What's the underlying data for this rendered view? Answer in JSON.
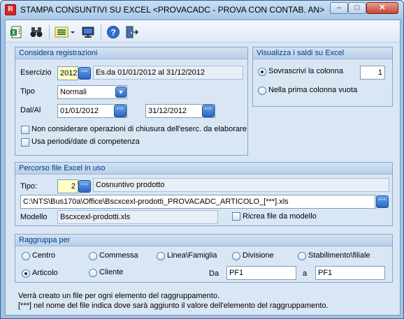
{
  "window": {
    "title": "STAMPA CONSUNTIVI SU EXCEL <PROVACADC - PROVA CON CONTAB. AN>",
    "app_icon": "R"
  },
  "toolbar": {
    "icons": [
      "export-excel-icon",
      "binoculars-icon",
      "list-menu-icon",
      "monitor-icon",
      "help-icon",
      "exit-icon"
    ]
  },
  "registrazioni": {
    "header": "Considera registrazioni",
    "esercizio_label": "Esercizio",
    "esercizio_value": "2012",
    "esercizio_desc": "Es.da 01/01/2012 al 31/12/2012",
    "tipo_label": "Tipo",
    "tipo_value": "Normali",
    "dalal_label": "Dal/Al",
    "dal_value": "01/01/2012",
    "al_value": "31/12/2012",
    "chk_chiusura_label": "Non considerare operazioni di chiusura dell'eserc. da elaborare",
    "chk_competenza_label": "Usa periodi/date di competenza"
  },
  "saldi": {
    "header": "Visualizza i saldi su Excel",
    "opt_sovrascrivi": "Sovrascrivi la colonna",
    "colonna_value": "1",
    "opt_prima_vuota": "Nella prima colonna vuota"
  },
  "percorso": {
    "header": "Percorso file Excel in uso",
    "tipo_label": "Tipo:",
    "tipo_value": "2",
    "tipo_desc": "Cosnuntivo prodotto",
    "path_value": "C:\\NTS\\Bus170a\\Office\\Bscxcexl-prodotti_PROVACADC_ARTICOLO_[***].xls",
    "modello_label": "Modello",
    "modello_value": "Bscxcexl-prodotti.xls",
    "ricrea_label": "Ricrea file da modello"
  },
  "raggruppa": {
    "header": "Raggruppa per",
    "opt_centro": "Centro",
    "opt_commessa": "Commessa",
    "opt_linea": "Linea\\Famiglia",
    "opt_divisione": "Divisione",
    "opt_stabilimento": "Stabilimento\\filiale",
    "opt_articolo": "Articolo",
    "opt_cliente": "Cliente",
    "da_label": "Da",
    "da_value": "PF1",
    "a_label": "a",
    "a_value": "PF1"
  },
  "notes": {
    "line1": "Verrà creato un file per ogni elemento del raggruppamento.",
    "line2": "[***] nel nome del file indica dove sarà aggiunto il valore dell'elemento del raggruppamento."
  }
}
